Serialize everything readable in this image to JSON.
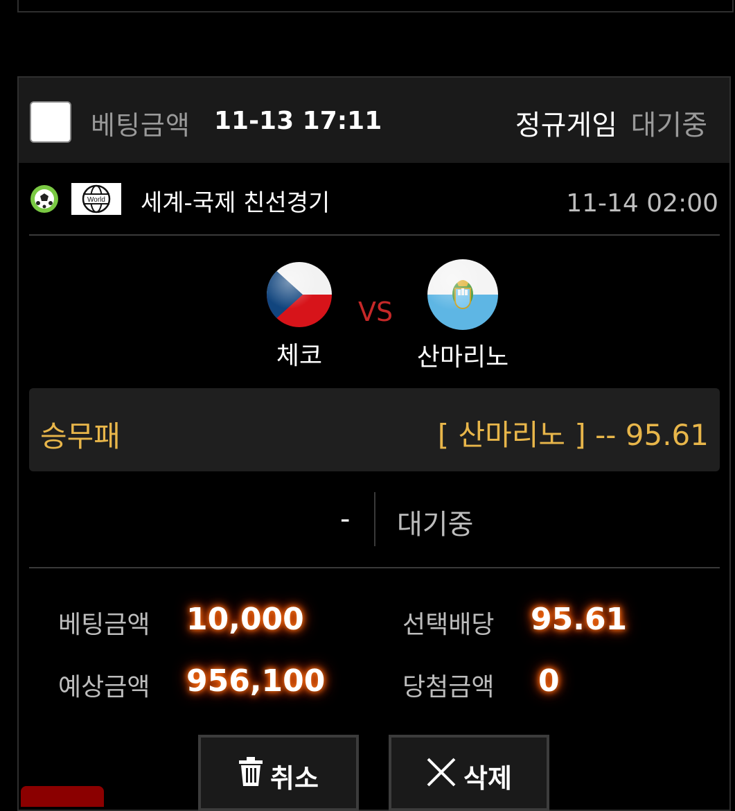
{
  "header": {
    "bet_label": "베팅금액",
    "bet_datetime": "11-13 17:11",
    "game_type": "정규게임",
    "status": "대기중"
  },
  "league": {
    "badge_text": "World",
    "name": "세계-국제 친선경기",
    "match_time": "11-14 02:00"
  },
  "match": {
    "home_team": "체코",
    "vs_label": "VS",
    "away_team": "산마리노"
  },
  "market": {
    "name": "승무패",
    "pick": "[ 산마리노 ] -- 95.61"
  },
  "result": {
    "score": "-",
    "status": "대기중"
  },
  "stats": {
    "bet_amount_label": "베팅금액",
    "bet_amount": "10,000",
    "selected_odds_label": "선택배당",
    "selected_odds": "95.61",
    "expected_amount_label": "예상금액",
    "expected_amount": "956,100",
    "win_amount_label": "당첨금액",
    "win_amount": "0"
  },
  "actions": {
    "cancel_label": "취소",
    "delete_label": "삭제"
  },
  "colors": {
    "accent_gold": "#e8b64a",
    "vs_red": "#c62828",
    "glow_orange": "#ff7a1a",
    "panel_bg": "#1f1f1f"
  },
  "icons": {
    "sport": "soccer-ball-icon",
    "region": "world-globe-icon",
    "cancel": "trash-icon",
    "delete": "x-icon"
  }
}
